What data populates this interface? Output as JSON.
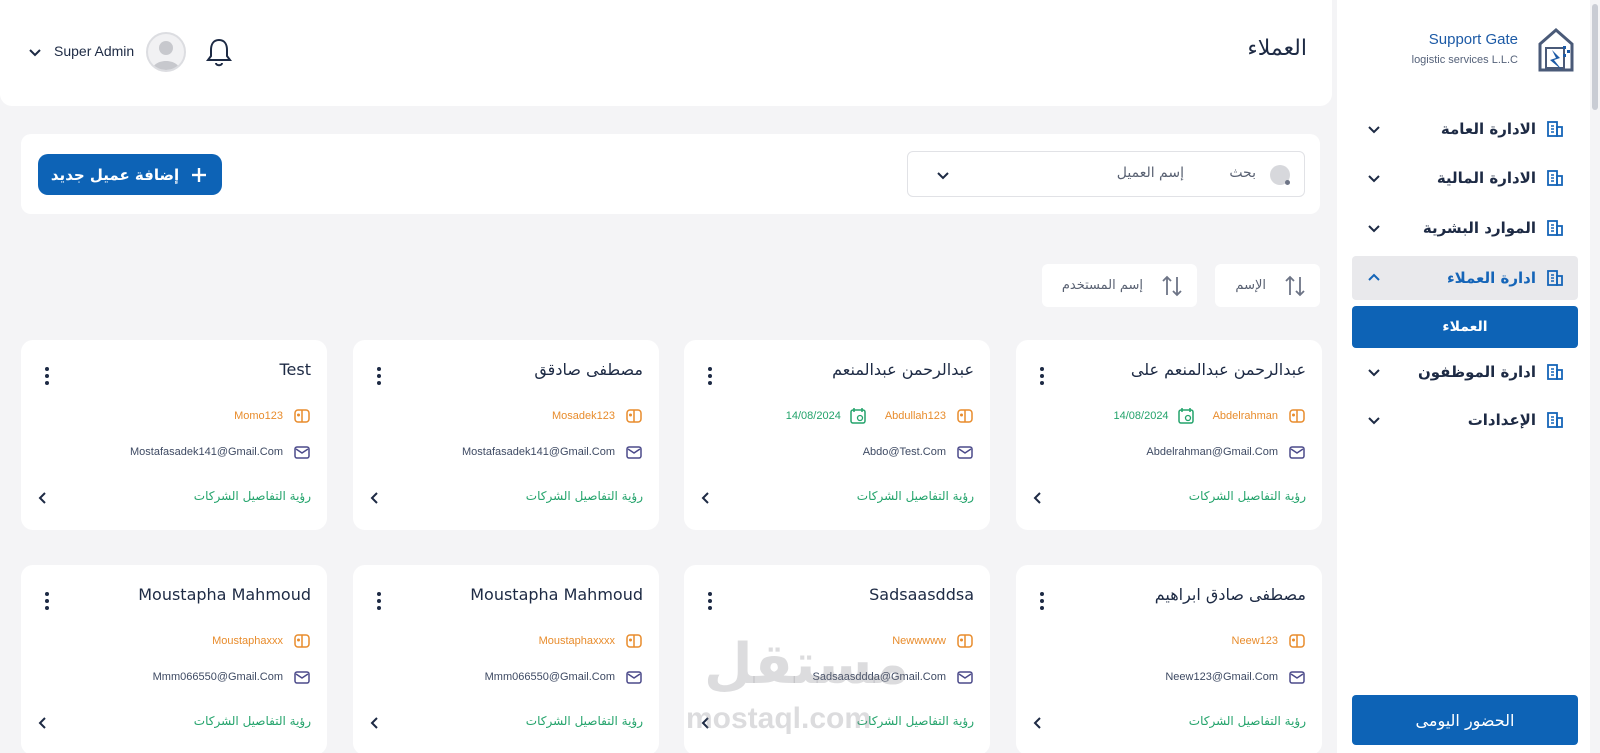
{
  "brand": {
    "name": "Support Gate",
    "subtitle": "logistic services L.L.C"
  },
  "sidebar": {
    "items": [
      {
        "label": "الادارة العامة",
        "icon": "building-icon",
        "expanded": false
      },
      {
        "label": "الادارة المالية",
        "icon": "building-icon",
        "expanded": false
      },
      {
        "label": "الموارد البشرية",
        "icon": "building-icon",
        "expanded": false
      },
      {
        "label": "ادارة العملاء",
        "icon": "building-icon",
        "expanded": true,
        "active": true
      },
      {
        "label": "ادارة الموظفون",
        "icon": "building-icon",
        "expanded": false
      },
      {
        "label": "الإعدادات",
        "icon": "building-icon",
        "expanded": false
      }
    ],
    "sub_items": [
      {
        "label": "العملاء",
        "active": true
      }
    ],
    "attendance_label": "الحضور اليومى"
  },
  "header": {
    "title": "العملاء",
    "user_name": "Super Admin",
    "notification_icon": "bell-icon"
  },
  "toolbar": {
    "add_label": "إضافة عميل جديد",
    "search_label": "بحث",
    "search_field": "إسم العميل"
  },
  "sort": {
    "name_label": "الإسم",
    "username_label": "إسم المستخدم"
  },
  "cards": [
    {
      "name": "عبدالرحمن عبدالمنعم على",
      "username": "Abdelrahman",
      "date": "14/08/2024",
      "email": "Abdelrahman@Gmail.Com",
      "details": "رؤية التفاصيل الشركات"
    },
    {
      "name": "عبدالرحمن عبدالمنعم",
      "username": "Abdullah123",
      "date": "14/08/2024",
      "email": "Abdo@Test.Com",
      "details": "رؤية التفاصيل الشركات"
    },
    {
      "name": "مصطفى صادقق",
      "username": "Mosadek123",
      "date": "",
      "email": "Mostafasadek141@Gmail.Com",
      "details": "رؤية التفاصيل الشركات"
    },
    {
      "name": "Test",
      "username": "Momo123",
      "date": "",
      "email": "Mostafasadek141@Gmail.Com",
      "details": "رؤية التفاصيل الشركات"
    },
    {
      "name": "مصطفى صادق ابراهيم",
      "username": "Neew123",
      "date": "",
      "email": "Neew123@Gmail.Com",
      "details": "رؤية التفاصيل الشركات"
    },
    {
      "name": "Sadsaasddsa",
      "username": "Newwwww",
      "date": "",
      "email": "Sadsaasddda@Gmail.Com",
      "details": "رؤية التفاصيل الشركات"
    },
    {
      "name": "Moustapha Mahmoud",
      "username": "Moustaphaxxxx",
      "date": "",
      "email": "Mmm066550@Gmail.Com",
      "details": "رؤية التفاصيل الشركات"
    },
    {
      "name": "Moustapha Mahmoud",
      "username": "Moustaphaxxx",
      "date": "",
      "email": "Mmm066550@Gmail.Com",
      "details": "رؤية التفاصيل الشركات"
    }
  ],
  "watermark": {
    "arabic": "مستقل",
    "latin": "mostaql.com"
  },
  "colors": {
    "primary": "#0d63b6",
    "accent_orange": "#e88c2c",
    "accent_green": "#23a36b",
    "text": "#1d2a44"
  }
}
